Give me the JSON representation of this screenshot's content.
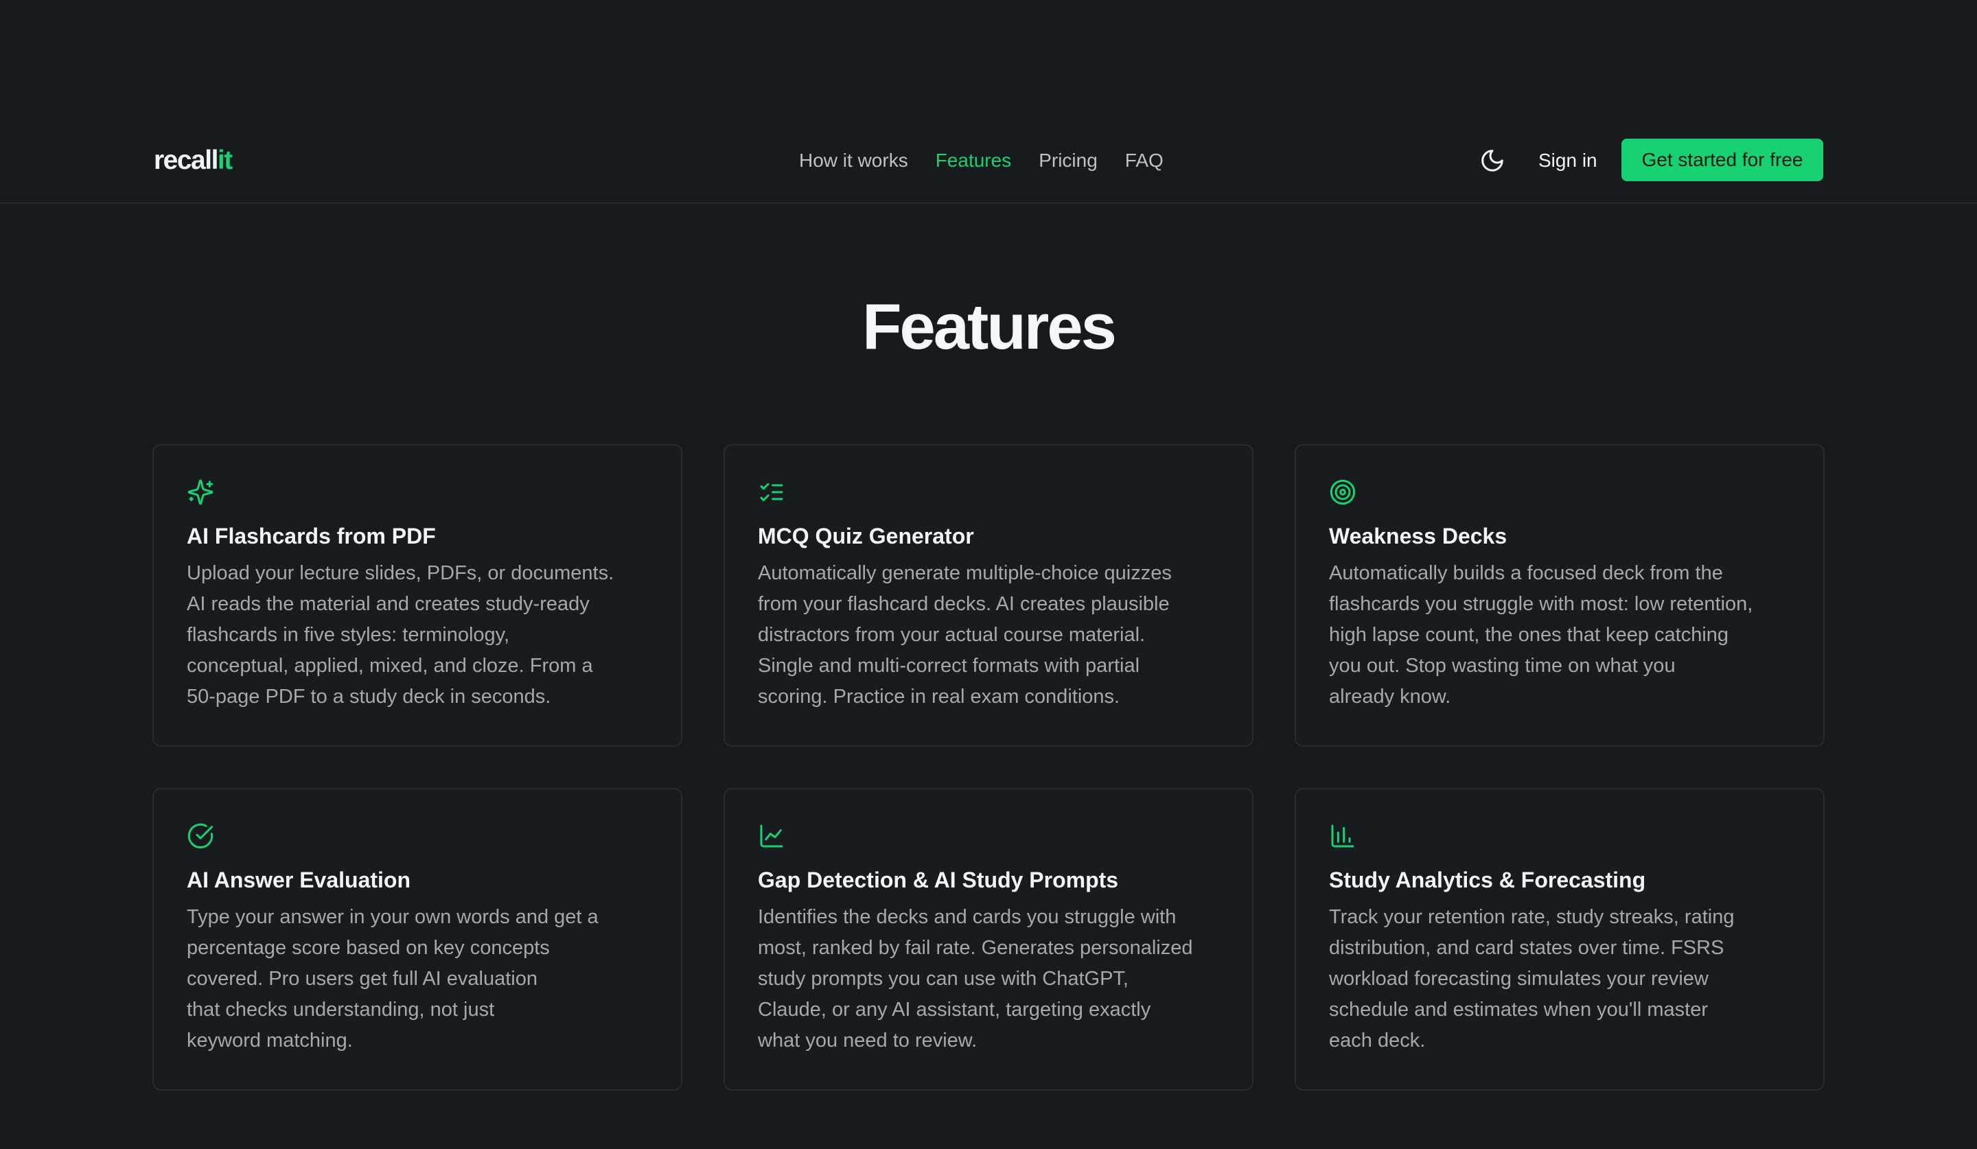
{
  "brand": {
    "name_main": "recall",
    "name_accent": "it",
    "accent_color": "#17d173"
  },
  "nav": {
    "items": [
      {
        "label": "How it works",
        "active": false
      },
      {
        "label": "Features",
        "active": true
      },
      {
        "label": "Pricing",
        "active": false
      },
      {
        "label": "FAQ",
        "active": false
      }
    ]
  },
  "header": {
    "theme_icon": "moon-icon",
    "signin_label": "Sign in",
    "cta_label": "Get started for free"
  },
  "main": {
    "title": "Features",
    "cards": [
      {
        "icon": "sparkles-icon",
        "title": "AI Flashcards from PDF",
        "body": "Upload your lecture slides, PDFs, or documents.\nAI reads the material and creates study-ready\nflashcards in five styles: terminology,\nconceptual, applied, mixed, and cloze. From a\n50-page PDF to a study deck in seconds."
      },
      {
        "icon": "checklist-icon",
        "title": "MCQ Quiz Generator",
        "body": "Automatically generate multiple-choice quizzes\nfrom your flashcard decks. AI creates plausible\ndistractors from your actual course material.\nSingle and multi-correct formats with partial\nscoring. Practice in real exam conditions."
      },
      {
        "icon": "target-icon",
        "title": "Weakness Decks",
        "body": "Automatically builds a focused deck from the\nflashcards you struggle with most: low retention,\nhigh lapse count, the ones that keep catching\nyou out. Stop wasting time on what you\nalready know."
      },
      {
        "icon": "check-circle-icon",
        "title": "AI Answer Evaluation",
        "body": "Type your answer in your own words and get a\npercentage score based on key concepts\ncovered. Pro users get full AI evaluation\nthat checks understanding, not just\nkeyword matching."
      },
      {
        "icon": "line-chart-icon",
        "title": "Gap Detection & AI Study Prompts",
        "body": "Identifies the decks and cards you struggle with\nmost, ranked by fail rate. Generates personalized\nstudy prompts you can use with ChatGPT,\nClaude, or any AI assistant, targeting exactly\nwhat you need to review."
      },
      {
        "icon": "bar-chart-icon",
        "title": "Study Analytics & Forecasting",
        "body": "Track your retention rate, study streaks, rating\ndistribution, and card states over time. FSRS\nworkload forecasting simulates your review\nschedule and estimates when you'll master\neach deck."
      }
    ]
  }
}
